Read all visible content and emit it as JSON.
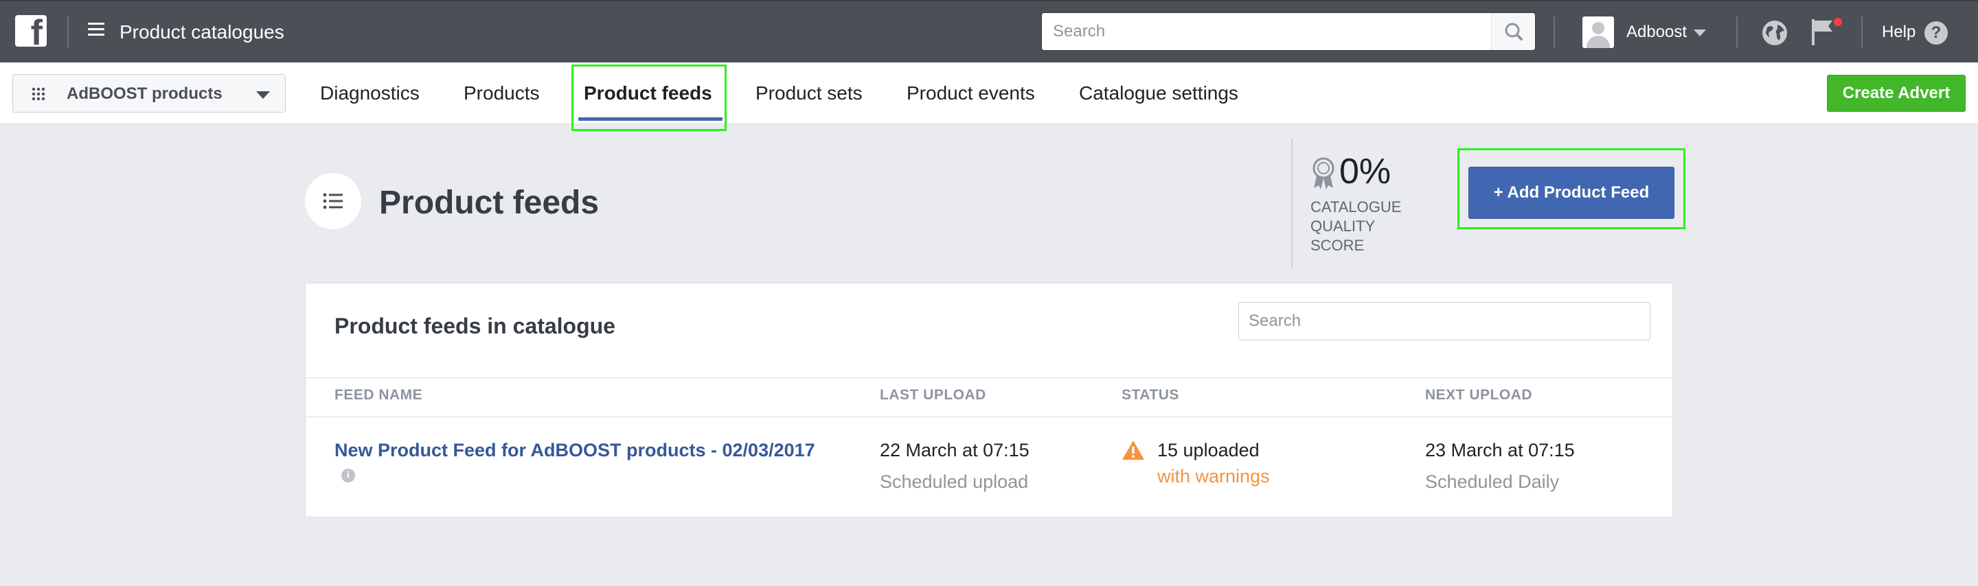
{
  "topbar": {
    "logo_icon": "facebook-logo-icon",
    "menu_icon": "hamburger-menu-icon",
    "app_title": "Product catalogues",
    "search_placeholder": "Search",
    "search_icon": "magnifier-icon",
    "user_name": "Adboost",
    "globe_icon": "globe-icon",
    "flag_icon": "flag-icon",
    "help_label": "Help",
    "help_glyph": "?"
  },
  "navbar": {
    "catalog_name": "AdBOOST products",
    "tabs": [
      {
        "label": "Diagnostics",
        "active": false
      },
      {
        "label": "Products",
        "active": false
      },
      {
        "label": "Product feeds",
        "active": true
      },
      {
        "label": "Product sets",
        "active": false
      },
      {
        "label": "Product events",
        "active": false
      },
      {
        "label": "Catalogue settings",
        "active": false
      }
    ],
    "create_advert_label": "Create Advert"
  },
  "header": {
    "title": "Product feeds",
    "quality_score": "0%",
    "quality_label": "CATALOGUE QUALITY SCORE",
    "add_feed_label": "+ Add Product Feed"
  },
  "feeds_card": {
    "title": "Product feeds in catalogue",
    "search_placeholder": "Search",
    "columns": [
      "FEED NAME",
      "LAST UPLOAD",
      "STATUS",
      "NEXT UPLOAD"
    ],
    "rows": [
      {
        "feed_name": "New Product Feed for AdBOOST products - 02/03/2017",
        "info_glyph": "i",
        "last_upload": "22 March at 07:15",
        "last_upload_sub": "Scheduled upload",
        "status": "15 uploaded",
        "status_sub": "with warnings",
        "next_upload": "23 March at 07:15",
        "next_upload_sub": "Scheduled Daily"
      }
    ]
  },
  "colors": {
    "topbar": "#4b4f56",
    "accent_blue": "#4267b2",
    "link_blue": "#365899",
    "green": "#42b72a",
    "warning_orange": "#f7923b",
    "highlight_green": "#2df01e",
    "page_bg": "#e9ebee"
  }
}
